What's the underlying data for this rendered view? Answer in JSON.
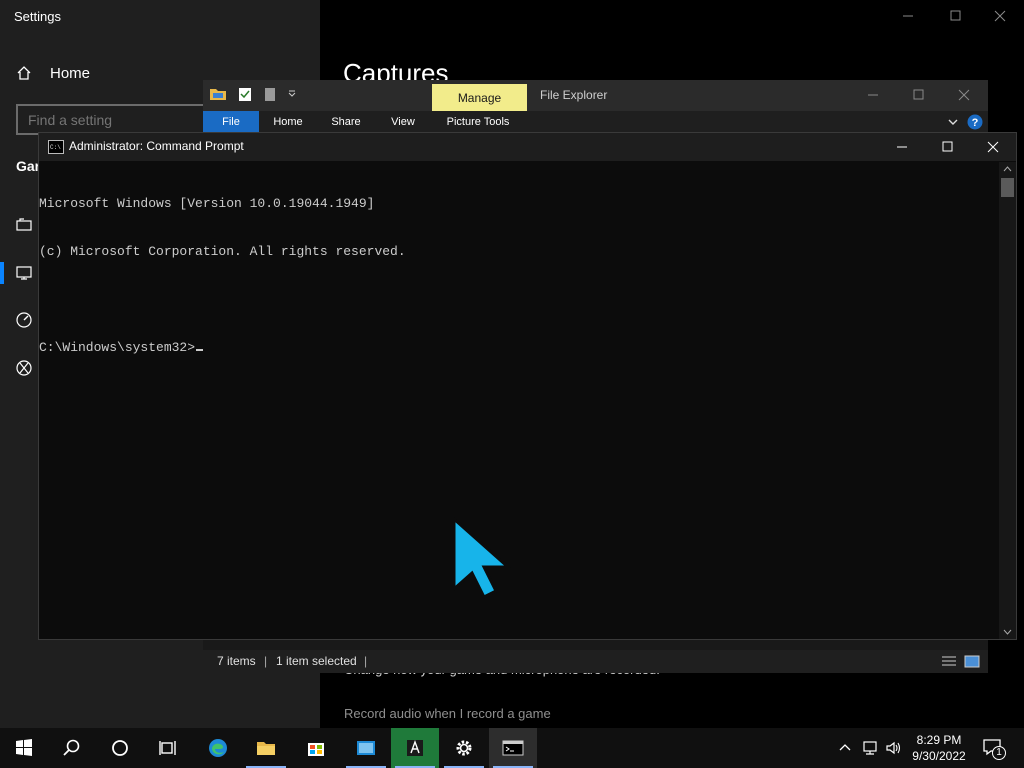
{
  "settings": {
    "window_title": "Settings",
    "home_label": "Home",
    "search_placeholder": "Find a setting",
    "section_heading_partial": "Gar",
    "main_title_partial": "Captures",
    "description_partial": "Change how your game and microphone are recorded.",
    "record_audio_label": "Record audio when I record a game"
  },
  "explorer": {
    "title": "File Explorer",
    "contextual_tab": "Manage",
    "ribbon_tabs": [
      "File",
      "Home",
      "Share",
      "View",
      "Picture Tools"
    ],
    "status": {
      "items": "7 items",
      "selected": "1 item selected"
    }
  },
  "cmd": {
    "title": "Administrator: Command Prompt",
    "lines": [
      "Microsoft Windows [Version 10.0.19044.1949]",
      "(c) Microsoft Corporation. All rights reserved.",
      "",
      "C:\\Windows\\system32>"
    ]
  },
  "taskbar": {
    "apps": [
      "start-icon",
      "search-icon",
      "cortana-icon",
      "task-view-icon",
      "edge-icon",
      "file-explorer-icon",
      "store-icon",
      "photos-icon",
      "adobe-icon",
      "settings-gear-icon",
      "command-prompt-icon"
    ],
    "clock_time": "8:29 PM",
    "clock_date": "9/30/2022",
    "notification_count": "1"
  },
  "colors": {
    "accent_blue": "#1a6bc4",
    "manage_tab": "#f2ec8b",
    "pointer": "#17b4ea"
  }
}
